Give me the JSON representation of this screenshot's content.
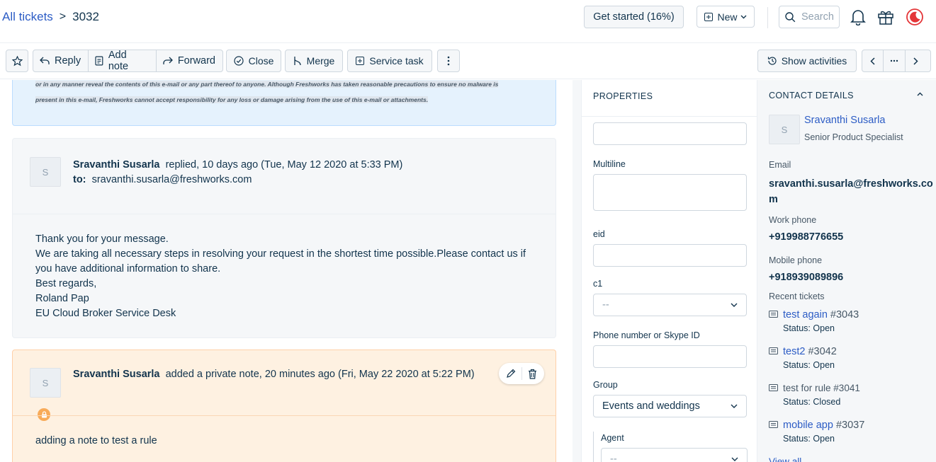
{
  "breadcrumb": {
    "all_tickets": "All tickets",
    "separator": ">",
    "ticket_id": "3032"
  },
  "header": {
    "get_started": "Get started (16%)",
    "new_label": "New",
    "search_placeholder": "Search"
  },
  "toolbar": {
    "reply": "Reply",
    "add_note": "Add note",
    "forward": "Forward",
    "close": "Close",
    "merge": "Merge",
    "service_task": "Service task",
    "show_activities": "Show activities"
  },
  "legal_notice": {
    "line1": "or in any manner reveal the contents of this e-mail or any part thereof to anyone. Although Freshworks has taken reasonable precautions to ensure no malware is",
    "line2": "present in this e-mail, Freshworks cannot accept responsibility for any loss or damage arising from the use of this e-mail or attachments."
  },
  "conversation": {
    "avatar": "S",
    "author": "Sravanthi Susarla",
    "action": "replied, 10 days ago (Tue, May 12 2020 at 5:33 PM)",
    "to_label": "to:",
    "to_address": "sravanthi.susarla@freshworks.com",
    "body": [
      "Thank you for your message.",
      "We are taking all necessary steps in resolving your request in the shortest time possible.Please contact us if",
      "you have additional information to share.",
      "Best regards,",
      "Roland Pap",
      "EU Cloud Broker Service Desk"
    ]
  },
  "note": {
    "avatar": "S",
    "author": "Sravanthi Susarla",
    "action": "added a private note, 20 minutes ago (Fri, May 22 2020 at 5:22 PM)",
    "body": "adding a note to test a rule"
  },
  "properties": {
    "title": "PROPERTIES",
    "multiline_label": "Multiline",
    "eid_label": "eid",
    "c1_label": "c1",
    "c1_value": "--",
    "phone_label": "Phone number or Skype ID",
    "group_label": "Group",
    "group_value": "Events and weddings",
    "agent_label": "Agent",
    "agent_value": "--"
  },
  "contact": {
    "title": "CONTACT DETAILS",
    "avatar": "S",
    "name": "Sravanthi Susarla",
    "role": "Senior Product Specialist",
    "email_label": "Email",
    "email_line1": "sravanthi.susarla@freshworks.co",
    "email_line2": "m",
    "work_phone_label": "Work phone",
    "work_phone": "+919988776655",
    "mobile_phone_label": "Mobile phone",
    "mobile_phone": "+918939089896",
    "recent_tickets_label": "Recent tickets",
    "tickets": [
      {
        "title": "test again",
        "number": "#3043",
        "status_label": "Status:",
        "status": "Open",
        "linked": true
      },
      {
        "title": "test2",
        "number": "#3042",
        "status_label": "Status:",
        "status": "Open",
        "linked": true
      },
      {
        "title": "test for rule",
        "number": "#3041",
        "status_label": "Status:",
        "status": "Closed",
        "linked": false
      },
      {
        "title": "mobile app",
        "number": "#3037",
        "status_label": "Status:",
        "status": "Open",
        "linked": true
      }
    ],
    "view_all": "View all"
  },
  "colors": {
    "link": "#2c5cc5",
    "brand_red": "#e43538",
    "note_bg": "#fef1e1",
    "lock": "#f8ab59"
  }
}
